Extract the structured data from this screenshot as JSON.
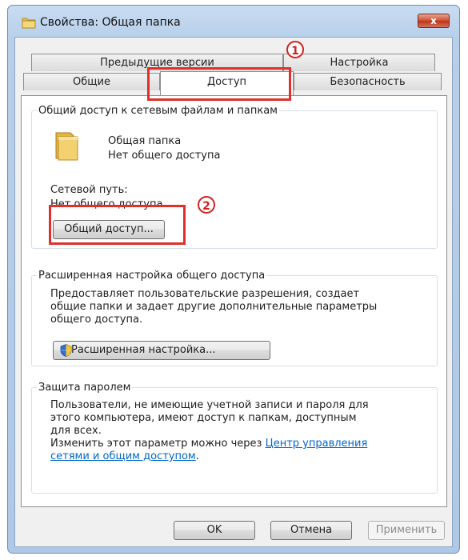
{
  "window": {
    "title": "Свойства: Общая папка",
    "close_label": "x"
  },
  "tabs_back": [
    {
      "label": "Предыдущие версии"
    },
    {
      "label": "Настройка"
    }
  ],
  "tabs_front": [
    {
      "label": "Общие"
    },
    {
      "label": "Доступ",
      "active": true
    },
    {
      "label": "Безопасность"
    }
  ],
  "sharing": {
    "legend": "Общий доступ к сетевым файлам и папкам",
    "folder_name": "Общая папка",
    "folder_status": "Нет общего доступа",
    "network_path_label": "Сетевой путь:",
    "network_path_value": "Нет общего доступа",
    "share_button": "Общий доступ..."
  },
  "advanced": {
    "legend": "Расширенная настройка общего доступа",
    "description_lines": [
      "Предоставляет пользовательские разрешения, создает",
      "общие папки и задает другие дополнительные параметры",
      "общего доступа."
    ],
    "button": "Расширенная настройка..."
  },
  "password": {
    "legend": "Защита паролем",
    "description_lines": [
      "Пользователи, не имеющие учетной записи и пароля для",
      "этого компьютера, имеют доступ к папкам, доступным",
      "для всех."
    ],
    "change_text": "Изменить этот параметр можно через",
    "link_line1": "Центр управления",
    "link_line2": "сетями и общим доступом",
    "link_suffix": "."
  },
  "footer": {
    "ok": "OK",
    "cancel": "Отмена",
    "apply": "Применить"
  },
  "annotations": {
    "marker1": "1",
    "marker2": "2",
    "color": "#e0302a"
  },
  "colors": {
    "link": "#0066cc",
    "title_bar": "#b9d1ea"
  }
}
